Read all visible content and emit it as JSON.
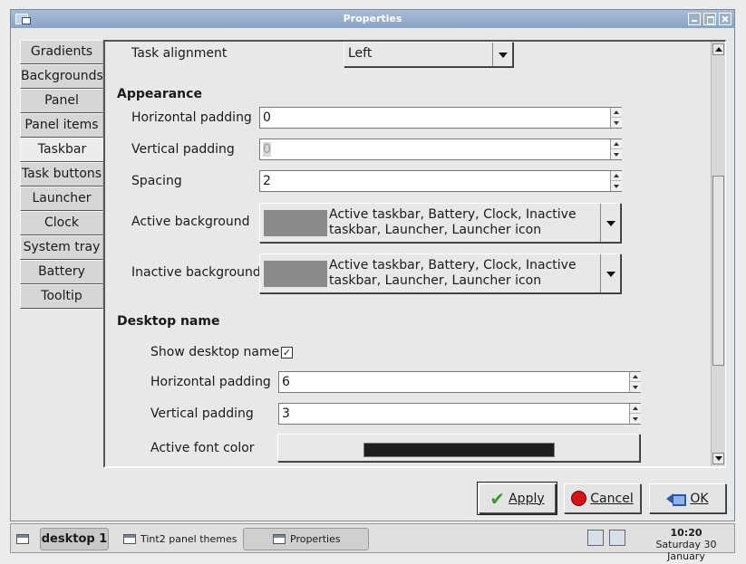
{
  "window": {
    "title": "Properties"
  },
  "sidebar": {
    "items": [
      {
        "label": "Gradients"
      },
      {
        "label": "Backgrounds"
      },
      {
        "label": "Panel"
      },
      {
        "label": "Panel items"
      },
      {
        "label": "Taskbar"
      },
      {
        "label": "Task buttons"
      },
      {
        "label": "Launcher"
      },
      {
        "label": "Clock"
      },
      {
        "label": "System tray"
      },
      {
        "label": "Battery"
      },
      {
        "label": "Tooltip"
      }
    ],
    "active": "Taskbar"
  },
  "taskbar_settings": {
    "task_alignment": {
      "label": "Task alignment",
      "value": "Left"
    },
    "appearance": {
      "heading": "Appearance",
      "horizontal_padding": {
        "label": "Horizontal padding",
        "value": "0"
      },
      "vertical_padding": {
        "label": "Vertical padding",
        "value": "0"
      },
      "spacing": {
        "label": "Spacing",
        "value": "2"
      },
      "active_background": {
        "label": "Active background",
        "value": "Active taskbar, Battery, Clock, Inactive taskbar, Launcher, Launcher icon",
        "swatch_color": "#8a8a8a"
      },
      "inactive_background": {
        "label": "Inactive background",
        "value": "Active taskbar, Battery, Clock, Inactive taskbar, Launcher, Launcher icon",
        "swatch_color": "#8a8a8a"
      }
    },
    "desktop_name": {
      "heading": "Desktop name",
      "show_desktop_name": {
        "label": "Show desktop name",
        "checked": true,
        "mark": "✓"
      },
      "horizontal_padding": {
        "label": "Horizontal padding",
        "value": "6"
      },
      "vertical_padding": {
        "label": "Vertical padding",
        "value": "3"
      },
      "active_font_color": {
        "label": "Active font color",
        "color": "#1e1e1e"
      }
    }
  },
  "buttons": {
    "apply": "Apply",
    "cancel": "Cancel",
    "ok": "OK"
  },
  "system_taskbar": {
    "desktop": "desktop 1",
    "tasks": [
      {
        "label": "Tint2 panel themes",
        "icon": "window-icon"
      },
      {
        "label": "Properties",
        "icon": "window-icon",
        "active": true
      }
    ],
    "tray_icons": [
      "network-icon",
      "volume-icon"
    ],
    "clock": {
      "time": "10:20",
      "date": "Saturday 30 January"
    }
  }
}
